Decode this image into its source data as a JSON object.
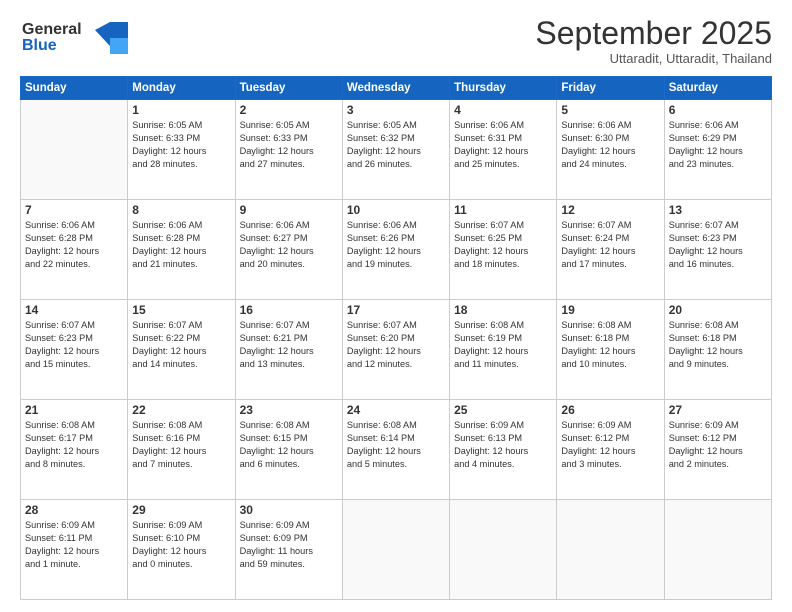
{
  "logo": {
    "line1": "General",
    "line2": "Blue"
  },
  "title": "September 2025",
  "subtitle": "Uttaradit, Uttaradit, Thailand",
  "weekdays": [
    "Sunday",
    "Monday",
    "Tuesday",
    "Wednesday",
    "Thursday",
    "Friday",
    "Saturday"
  ],
  "weeks": [
    [
      {
        "day": "",
        "info": ""
      },
      {
        "day": "1",
        "info": "Sunrise: 6:05 AM\nSunset: 6:33 PM\nDaylight: 12 hours\nand 28 minutes."
      },
      {
        "day": "2",
        "info": "Sunrise: 6:05 AM\nSunset: 6:33 PM\nDaylight: 12 hours\nand 27 minutes."
      },
      {
        "day": "3",
        "info": "Sunrise: 6:05 AM\nSunset: 6:32 PM\nDaylight: 12 hours\nand 26 minutes."
      },
      {
        "day": "4",
        "info": "Sunrise: 6:06 AM\nSunset: 6:31 PM\nDaylight: 12 hours\nand 25 minutes."
      },
      {
        "day": "5",
        "info": "Sunrise: 6:06 AM\nSunset: 6:30 PM\nDaylight: 12 hours\nand 24 minutes."
      },
      {
        "day": "6",
        "info": "Sunrise: 6:06 AM\nSunset: 6:29 PM\nDaylight: 12 hours\nand 23 minutes."
      }
    ],
    [
      {
        "day": "7",
        "info": "Sunrise: 6:06 AM\nSunset: 6:28 PM\nDaylight: 12 hours\nand 22 minutes."
      },
      {
        "day": "8",
        "info": "Sunrise: 6:06 AM\nSunset: 6:28 PM\nDaylight: 12 hours\nand 21 minutes."
      },
      {
        "day": "9",
        "info": "Sunrise: 6:06 AM\nSunset: 6:27 PM\nDaylight: 12 hours\nand 20 minutes."
      },
      {
        "day": "10",
        "info": "Sunrise: 6:06 AM\nSunset: 6:26 PM\nDaylight: 12 hours\nand 19 minutes."
      },
      {
        "day": "11",
        "info": "Sunrise: 6:07 AM\nSunset: 6:25 PM\nDaylight: 12 hours\nand 18 minutes."
      },
      {
        "day": "12",
        "info": "Sunrise: 6:07 AM\nSunset: 6:24 PM\nDaylight: 12 hours\nand 17 minutes."
      },
      {
        "day": "13",
        "info": "Sunrise: 6:07 AM\nSunset: 6:23 PM\nDaylight: 12 hours\nand 16 minutes."
      }
    ],
    [
      {
        "day": "14",
        "info": "Sunrise: 6:07 AM\nSunset: 6:23 PM\nDaylight: 12 hours\nand 15 minutes."
      },
      {
        "day": "15",
        "info": "Sunrise: 6:07 AM\nSunset: 6:22 PM\nDaylight: 12 hours\nand 14 minutes."
      },
      {
        "day": "16",
        "info": "Sunrise: 6:07 AM\nSunset: 6:21 PM\nDaylight: 12 hours\nand 13 minutes."
      },
      {
        "day": "17",
        "info": "Sunrise: 6:07 AM\nSunset: 6:20 PM\nDaylight: 12 hours\nand 12 minutes."
      },
      {
        "day": "18",
        "info": "Sunrise: 6:08 AM\nSunset: 6:19 PM\nDaylight: 12 hours\nand 11 minutes."
      },
      {
        "day": "19",
        "info": "Sunrise: 6:08 AM\nSunset: 6:18 PM\nDaylight: 12 hours\nand 10 minutes."
      },
      {
        "day": "20",
        "info": "Sunrise: 6:08 AM\nSunset: 6:18 PM\nDaylight: 12 hours\nand 9 minutes."
      }
    ],
    [
      {
        "day": "21",
        "info": "Sunrise: 6:08 AM\nSunset: 6:17 PM\nDaylight: 12 hours\nand 8 minutes."
      },
      {
        "day": "22",
        "info": "Sunrise: 6:08 AM\nSunset: 6:16 PM\nDaylight: 12 hours\nand 7 minutes."
      },
      {
        "day": "23",
        "info": "Sunrise: 6:08 AM\nSunset: 6:15 PM\nDaylight: 12 hours\nand 6 minutes."
      },
      {
        "day": "24",
        "info": "Sunrise: 6:08 AM\nSunset: 6:14 PM\nDaylight: 12 hours\nand 5 minutes."
      },
      {
        "day": "25",
        "info": "Sunrise: 6:09 AM\nSunset: 6:13 PM\nDaylight: 12 hours\nand 4 minutes."
      },
      {
        "day": "26",
        "info": "Sunrise: 6:09 AM\nSunset: 6:12 PM\nDaylight: 12 hours\nand 3 minutes."
      },
      {
        "day": "27",
        "info": "Sunrise: 6:09 AM\nSunset: 6:12 PM\nDaylight: 12 hours\nand 2 minutes."
      }
    ],
    [
      {
        "day": "28",
        "info": "Sunrise: 6:09 AM\nSunset: 6:11 PM\nDaylight: 12 hours\nand 1 minute."
      },
      {
        "day": "29",
        "info": "Sunrise: 6:09 AM\nSunset: 6:10 PM\nDaylight: 12 hours\nand 0 minutes."
      },
      {
        "day": "30",
        "info": "Sunrise: 6:09 AM\nSunset: 6:09 PM\nDaylight: 11 hours\nand 59 minutes."
      },
      {
        "day": "",
        "info": ""
      },
      {
        "day": "",
        "info": ""
      },
      {
        "day": "",
        "info": ""
      },
      {
        "day": "",
        "info": ""
      }
    ]
  ]
}
